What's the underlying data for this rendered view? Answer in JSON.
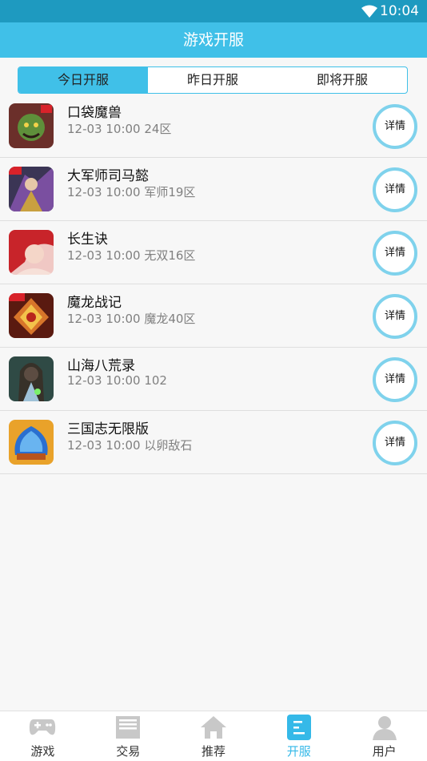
{
  "status": {
    "time": "10:04"
  },
  "header": {
    "title": "游戏开服"
  },
  "tabs": [
    {
      "label": "今日开服",
      "active": true
    },
    {
      "label": "昨日开服",
      "active": false
    },
    {
      "label": "即将开服",
      "active": false
    }
  ],
  "items": [
    {
      "name": "口袋魔兽",
      "meta": "12-03 10:00 24区",
      "detail": "详情",
      "icon": "game-icon"
    },
    {
      "name": "大军师司马懿",
      "meta": "12-03 10:00 军师19区",
      "detail": "详情",
      "icon": "game-icon"
    },
    {
      "name": "长生诀",
      "meta": "12-03 10:00 无双16区",
      "detail": "详情",
      "icon": "game-icon"
    },
    {
      "name": "魔龙战记",
      "meta": "12-03 10:00 魔龙40区",
      "detail": "详情",
      "icon": "game-icon"
    },
    {
      "name": "山海八荒录",
      "meta": "12-03 10:00 102",
      "detail": "详情",
      "icon": "game-icon"
    },
    {
      "name": "三国志无限版",
      "meta": "12-03 10:00 以卵敌石",
      "detail": "详情",
      "icon": "game-icon"
    }
  ],
  "tabbar": [
    {
      "label": "游戏",
      "icon": "gamepad-icon",
      "active": false
    },
    {
      "label": "交易",
      "icon": "trade-icon",
      "active": false
    },
    {
      "label": "推荐",
      "icon": "home-icon",
      "active": false
    },
    {
      "label": "开服",
      "icon": "server-icon",
      "active": true
    },
    {
      "label": "用户",
      "icon": "user-icon",
      "active": false
    }
  ],
  "colors": {
    "primary": "#40c0e8",
    "status_bar": "#1e9ac0",
    "detail_ring": "#7fd2ec",
    "active_tab_text": "#35b9e8"
  }
}
